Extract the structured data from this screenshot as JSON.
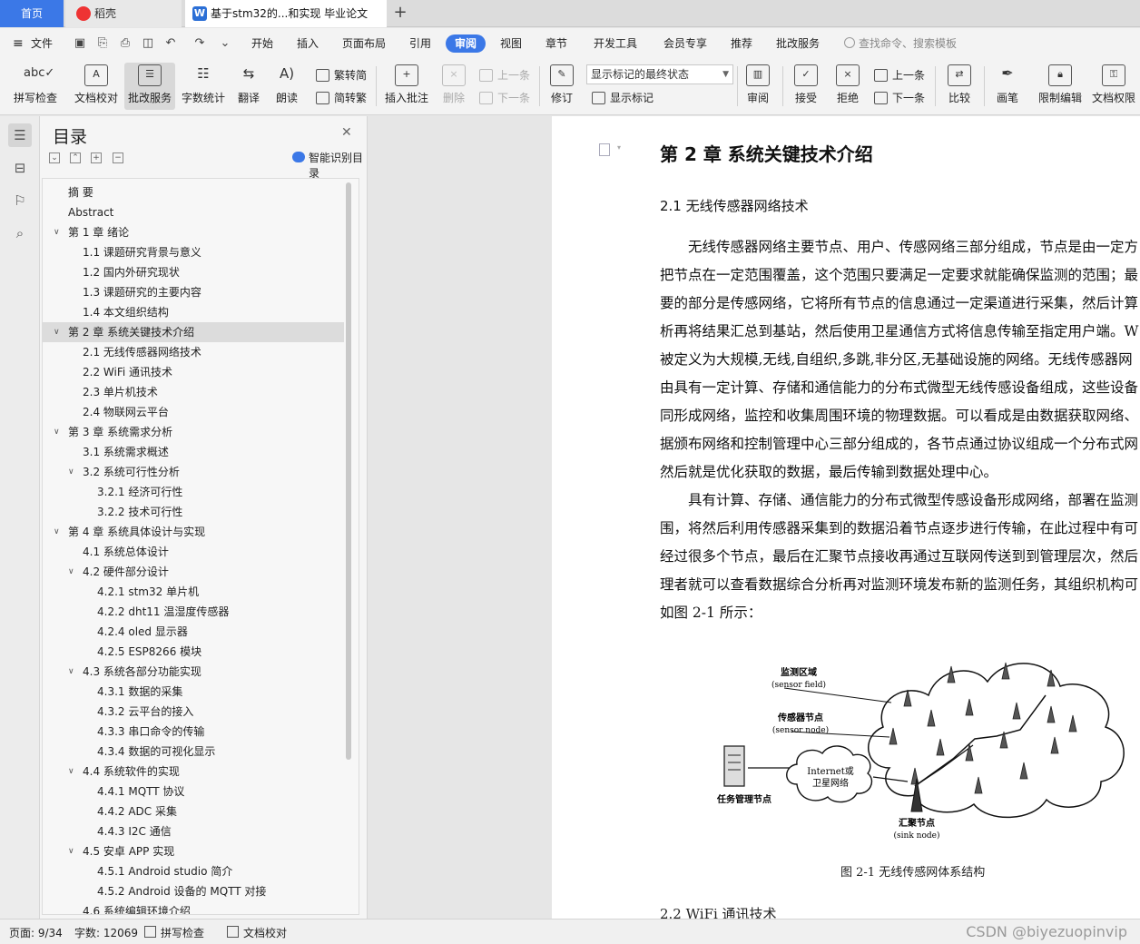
{
  "tabs": {
    "home": "首页",
    "daoke": "稻壳",
    "doc": "基于stm32的...和实现 毕业论文"
  },
  "menu": {
    "file": "文件",
    "items": [
      "开始",
      "插入",
      "页面布局",
      "引用",
      "审阅",
      "视图",
      "章节",
      "开发工具",
      "会员专享",
      "推荐",
      "批改服务"
    ],
    "active": "审阅",
    "search_placeholder": "查找命令、搜索模板"
  },
  "ribbon": {
    "spell_check": "拼写检查",
    "doc_proof": "文档校对",
    "correction_service": "批改服务",
    "word_count": "字数统计",
    "translate": "翻译",
    "read_aloud": "朗读",
    "trad_to_simp": "繁转简",
    "simp_to_trad": "简转繁",
    "insert_comment": "插入批注",
    "delete": "删除",
    "prev_comment": "上一条",
    "next_comment": "下一条",
    "revise": "修订",
    "markup_state": "显示标记的最终状态",
    "show_markup": "显示标记",
    "review": "审阅",
    "accept": "接受",
    "reject": "拒绝",
    "prev_change": "上一条",
    "next_change": "下一条",
    "compare": "比较",
    "pen": "画笔",
    "restrict_edit": "限制编辑",
    "doc_permission": "文档权限"
  },
  "toc": {
    "title": "目录",
    "smart_detect": "智能识别目录",
    "items": [
      {
        "text": "摘  要",
        "level": 0,
        "caret": false
      },
      {
        "text": "Abstract",
        "level": 0,
        "caret": false
      },
      {
        "text": "第 1 章  绪论",
        "level": 0,
        "caret": true
      },
      {
        "text": "1.1  课题研究背景与意义",
        "level": 1,
        "caret": false
      },
      {
        "text": "1.2  国内外研究现状",
        "level": 1,
        "caret": false
      },
      {
        "text": "1.3  课题研究的主要内容",
        "level": 1,
        "caret": false
      },
      {
        "text": "1.4  本文组织结构",
        "level": 1,
        "caret": false
      },
      {
        "text": "第 2 章  系统关键技术介绍",
        "level": 0,
        "caret": true,
        "selected": true
      },
      {
        "text": "2.1  无线传感器网络技术",
        "level": 1,
        "caret": false
      },
      {
        "text": "2.2 WiFi 通讯技术",
        "level": 1,
        "caret": false
      },
      {
        "text": "2.3  单片机技术",
        "level": 1,
        "caret": false
      },
      {
        "text": "2.4  物联网云平台",
        "level": 1,
        "caret": false
      },
      {
        "text": "第 3 章  系统需求分析",
        "level": 0,
        "caret": true
      },
      {
        "text": "3.1  系统需求概述",
        "level": 1,
        "caret": false
      },
      {
        "text": "3.2  系统可行性分析",
        "level": 1,
        "caret": true
      },
      {
        "text": "3.2.1  经济可行性",
        "level": 2,
        "caret": false
      },
      {
        "text": "3.2.2  技术可行性",
        "level": 2,
        "caret": false
      },
      {
        "text": "第 4 章  系统具体设计与实现",
        "level": 0,
        "caret": true
      },
      {
        "text": "4.1  系统总体设计",
        "level": 1,
        "caret": false
      },
      {
        "text": "4.2  硬件部分设计",
        "level": 1,
        "caret": true
      },
      {
        "text": "4.2.1 stm32 单片机",
        "level": 2,
        "caret": false
      },
      {
        "text": "4.2.2 dht11 温湿度传感器",
        "level": 2,
        "caret": false
      },
      {
        "text": "4.2.4 oled 显示器",
        "level": 2,
        "caret": false
      },
      {
        "text": "4.2.5 ESP8266 模块",
        "level": 2,
        "caret": false
      },
      {
        "text": "4.3  系统各部分功能实现",
        "level": 1,
        "caret": true
      },
      {
        "text": "4.3.1 数据的采集",
        "level": 2,
        "caret": false
      },
      {
        "text": "4.3.2 云平台的接入",
        "level": 2,
        "caret": false
      },
      {
        "text": "4.3.3  串口命令的传输",
        "level": 2,
        "caret": false
      },
      {
        "text": "4.3.4 数据的可视化显示",
        "level": 2,
        "caret": false
      },
      {
        "text": "4.4  系统软件的实现",
        "level": 1,
        "caret": true
      },
      {
        "text": "4.4.1 MQTT 协议",
        "level": 2,
        "caret": false
      },
      {
        "text": "4.4.2 ADC 采集",
        "level": 2,
        "caret": false
      },
      {
        "text": "4.4.3 I2C 通信",
        "level": 2,
        "caret": false
      },
      {
        "text": "4.5  安卓 APP 实现",
        "level": 1,
        "caret": true
      },
      {
        "text": "4.5.1 Android studio 简介",
        "level": 2,
        "caret": false
      },
      {
        "text": "4.5.2 Android 设备的 MQTT 对接",
        "level": 2,
        "caret": false
      },
      {
        "text": "4.6  系统编辑环境介绍",
        "level": 1,
        "caret": false
      }
    ]
  },
  "document": {
    "chapter_title": "第 2 章  系统关键技术介绍",
    "section_title": "2.1  无线传感器网络技术",
    "lines": [
      "　　无线传感器网络主要节点、用户、传感网络三部分组成，节点是由一定方",
      "把节点在一定范围覆盖，这个范围只要满足一定要求就能确保监测的范围；最",
      "要的部分是传感网络，它将所有节点的信息通过一定渠道进行采集，然后计算",
      "析再将结果汇总到基站，然后使用卫星通信方式将信息传输至指定用户端。W",
      "被定义为大规模,无线,自组织,多跳,非分区,无基础设施的网络。无线传感器网",
      "由具有一定计算、存储和通信能力的分布式微型无线传感设备组成，这些设备",
      "同形成网络，监控和收集周围环境的物理数据。可以看成是由数据获取网络、",
      "据颁布网络和控制管理中心三部分组成的，各节点通过协议组成一个分布式网",
      "然后就是优化获取的数据，最后传输到数据处理中心。",
      "　　具有计算、存储、通信能力的分布式微型传感设备形成网络，部署在监测",
      "围，将然后利用传感器采集到的数据沿着节点逐步进行传输，在此过程中有可",
      "经过很多个节点，最后在汇聚节点接收再通过互联网传送到到管理层次，然后",
      "理者就可以查看数据综合分析再对监测环境发布新的监测任务，其组织机构可",
      "如图 2-1 所示："
    ],
    "figure": {
      "sensor_field": "监测区域",
      "sensor_field_en": "(sensor field)",
      "sensor_node": "传感器节点",
      "sensor_node_en": "(sensor node)",
      "internet": "Internet或",
      "satellite": "卫星网络",
      "sink": "汇聚节点",
      "sink_en": "(sink node)",
      "task_manager": "任务管理节点"
    },
    "figure_caption": "图 2-1  无线传感网体系结构",
    "next_section": "2.2 WiFi 通讯技术"
  },
  "status": {
    "page": "页面: 9/34",
    "words": "字数: 12069",
    "spell_check": "拼写检查",
    "doc_proof": "文档校对",
    "watermark": "CSDN @biyezuopinvip"
  }
}
